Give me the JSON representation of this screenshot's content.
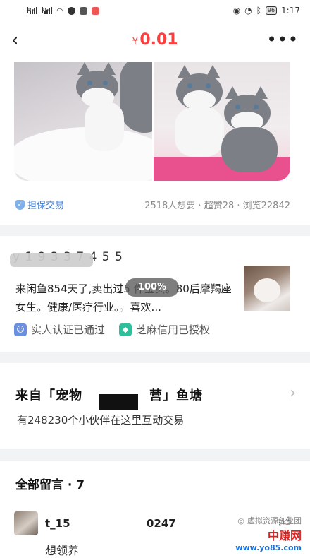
{
  "status_bar": {
    "battery": "96",
    "time": "1:17",
    "signal_tag": "4G"
  },
  "nav": {
    "back_glyph": "‹",
    "currency": "¥",
    "price": "0.01",
    "more_glyph": "•••"
  },
  "goods": {
    "guarantee_label": "担保交易",
    "stats": "2518人想要 · 超赞28 · 浏览22842"
  },
  "seller": {
    "name_partial": "y 1 9 3 3 7 4 5 5",
    "description": "来闲鱼854天了,卖出过5 件宝贝。80后摩羯座女生。健康/医疗行业。。喜欢...",
    "zoom_badge": "100%",
    "verify": [
      {
        "icon": "person-id-icon",
        "label": "实人认证已通过"
      },
      {
        "icon": "sesame-credit-icon",
        "label": "芝麻信用已授权"
      }
    ]
  },
  "pond": {
    "title": "来自「宠物　　　　　营」鱼塘",
    "subtitle": "有248230个小伙伴在这里互动交易"
  },
  "comments": {
    "title": "全部留言 · 7",
    "items": [
      {
        "user_prefix": "t_15",
        "user_suffix": "0247",
        "text": "想领养"
      }
    ]
  },
  "watermark": {
    "line1": "虚拟资源创业团",
    "brand": "中赚网",
    "url": "www.yo85.com"
  },
  "colors": {
    "price": "#ff3e3e",
    "link": "#3a7bd5",
    "page_bg": "#f2f3f5"
  }
}
